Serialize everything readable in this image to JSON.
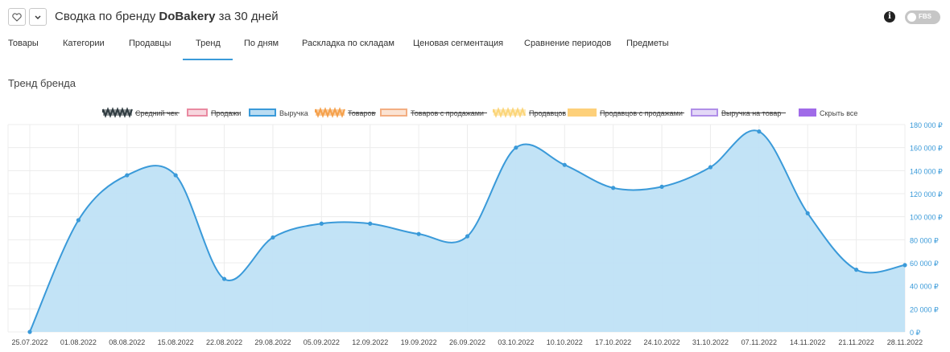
{
  "header": {
    "title_prefix": "Сводка по бренду ",
    "brand": "DoBakery",
    "title_suffix": " за 30 дней",
    "favorite_icon": "heart-icon",
    "dropdown_icon": "chevron-down-icon",
    "info_icon": "info-icon",
    "fbs_label": "FBS"
  },
  "tabs": [
    {
      "label": "Товары",
      "active": false
    },
    {
      "label": "Категории",
      "active": false
    },
    {
      "label": "Продавцы",
      "active": false
    },
    {
      "label": "Тренд",
      "active": true
    },
    {
      "label": "По дням",
      "active": false
    },
    {
      "label": "Раскладка по складам",
      "active": false
    },
    {
      "label": "Ценовая сегментация",
      "active": false
    },
    {
      "label": "Сравнение периодов",
      "active": false
    },
    {
      "label": "Предметы",
      "active": false
    }
  ],
  "section_title": "Тренд бренда",
  "colors": {
    "accent": "#3a9ad9",
    "area_fill": "#bfe1f5",
    "axis_text": "#3a9ad9"
  },
  "chart_data": {
    "type": "area",
    "legend_position": "top",
    "legend": [
      {
        "label": "Средний чек",
        "color": "#2f3b40",
        "hidden": true,
        "style": "zigzag"
      },
      {
        "label": "Продажи",
        "color": "#e98aa1",
        "hidden": true,
        "style": "box"
      },
      {
        "label": "Выручка",
        "color": "#3a9ad9",
        "hidden": false,
        "style": "box"
      },
      {
        "label": "Товаров",
        "color": "#f5a04a",
        "hidden": true,
        "style": "zigzag"
      },
      {
        "label": "Товаров с продажами",
        "color": "#f3ae82",
        "hidden": true,
        "style": "box"
      },
      {
        "label": "Продавцов",
        "color": "#fbd579",
        "hidden": true,
        "style": "zigzag"
      },
      {
        "label": "Продавцов с продажами",
        "color": "#fdd07a",
        "hidden": true,
        "style": "solid"
      },
      {
        "label": "Выручка на товар",
        "color": "#b08ee8",
        "hidden": true,
        "style": "box"
      },
      {
        "label": "Скрыть все",
        "color": "#a06be8",
        "hidden": false,
        "style": "solid"
      }
    ],
    "x": [
      "25.07.2022",
      "01.08.2022",
      "08.08.2022",
      "15.08.2022",
      "22.08.2022",
      "29.08.2022",
      "05.09.2022",
      "12.09.2022",
      "19.09.2022",
      "26.09.2022",
      "03.10.2022",
      "10.10.2022",
      "17.10.2022",
      "24.10.2022",
      "31.10.2022",
      "07.11.2022",
      "14.11.2022",
      "21.11.2022",
      "28.11.2022"
    ],
    "series": [
      {
        "name": "Выручка",
        "values": [
          0,
          97000,
          136000,
          136000,
          46000,
          82000,
          94000,
          94000,
          85000,
          83000,
          160000,
          145000,
          125000,
          126000,
          143000,
          174000,
          103000,
          54000,
          58000
        ]
      }
    ],
    "yticks": [
      "0 ₽",
      "20 000 ₽",
      "40 000 ₽",
      "60 000 ₽",
      "80 000 ₽",
      "100 000 ₽",
      "120 000 ₽",
      "140 000 ₽",
      "160 000 ₽",
      "180 000 ₽"
    ],
    "ylim": [
      0,
      180000
    ],
    "grid": true
  }
}
